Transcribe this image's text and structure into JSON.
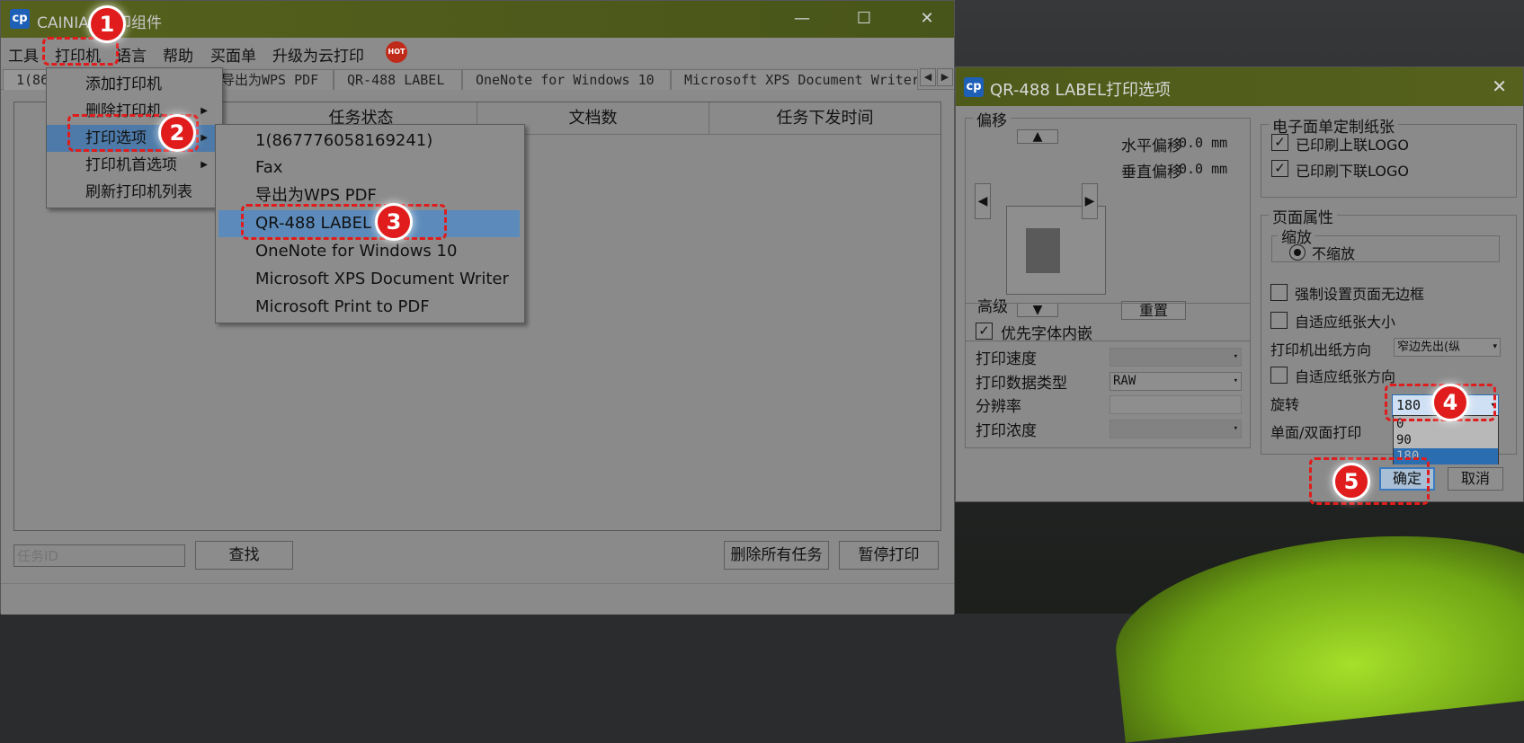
{
  "main_window": {
    "title": "CAINIAO打印组件",
    "min_btn": "—",
    "max_btn": "☐",
    "close_btn": "✕",
    "menus": [
      "工具",
      "打印机",
      "语言",
      "帮助",
      "买面单",
      "升级为云打印"
    ],
    "hot_badge": "HOT",
    "tabs": [
      "1(867",
      "导出为WPS PDF",
      "QR-488 LABEL",
      "OneNote for Windows 10",
      "Microsoft XPS Document Writer"
    ],
    "tab_prev": "◀",
    "tab_next": "▶",
    "columns": [
      "任务状态",
      "文档数",
      "任务下发时间"
    ],
    "task_id_placeholder": "任务ID",
    "search_btn": "查找",
    "delete_all_btn": "删除所有任务",
    "pause_btn": "暂停打印"
  },
  "printer_menu": {
    "items": [
      "添加打印机",
      "删除打印机",
      "打印选项",
      "打印机首选项",
      "刷新打印机列表"
    ],
    "submenu_arrow": "▶"
  },
  "print_options_submenu": {
    "items": [
      "1(867776058169241)",
      "Fax",
      "导出为WPS PDF",
      "QR-488 LABEL",
      "OneNote for Windows 10",
      "Microsoft XPS Document Writer",
      "Microsoft Print to PDF"
    ]
  },
  "dialog": {
    "title": "QR-488 LABEL打印选项",
    "close_btn": "✕",
    "offset": {
      "group_title": "偏移",
      "h_offset_label": "水平偏移",
      "h_offset_value": "0.0 mm",
      "v_offset_label": "垂直偏移",
      "v_offset_value": "0.0 mm",
      "reset_btn": "重置",
      "up_arrow": "▲",
      "down_arrow": "▼",
      "left_arrow": "◀",
      "right_arrow": "▶"
    },
    "advanced": {
      "group_title": "高级",
      "embed_fonts_label": "优先字体内嵌",
      "embed_fonts_checked": true,
      "print_speed_label": "打印速度",
      "data_type_label": "打印数据类型",
      "data_type_value": "RAW",
      "resolution_label": "分辨率",
      "density_label": "打印浓度"
    },
    "paper": {
      "group_title": "电子面单定制纸张",
      "upper_logo_label": "已印刷上联LOGO",
      "upper_logo_checked": true,
      "lower_logo_label": "已印刷下联LOGO",
      "lower_logo_checked": true
    },
    "page_props": {
      "group_title": "页面属性",
      "scale_title": "缩放",
      "no_scale_label": "不缩放",
      "borderless_label": "强制设置页面无边框",
      "fit_paper_label": "自适应纸张大小",
      "paper_out_label": "打印机出纸方向",
      "paper_out_value": "窄边先出(纵",
      "fit_orientation_label": "自适应纸张方向",
      "rotate_label": "旋转",
      "rotate_value": "180",
      "rotate_options": [
        "0",
        "90",
        "180"
      ],
      "duplex_label": "单面/双面打印"
    },
    "ok_btn": "确定",
    "cancel_btn": "取消",
    "combo_arrow": "▾"
  },
  "callouts": [
    "1",
    "2",
    "3",
    "4",
    "5"
  ],
  "accent_color": "#e01c1c"
}
